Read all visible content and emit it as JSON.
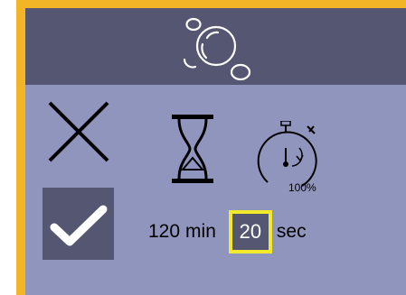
{
  "header": {
    "icon": "bubbles-icon"
  },
  "actions": {
    "cancel_icon": "close-icon",
    "confirm_icon": "checkmark-icon"
  },
  "indicators": {
    "hourglass_icon": "hourglass-icon",
    "timer_icon": "stopwatch-icon",
    "timer_percent": "100%"
  },
  "time": {
    "minutes": "120",
    "minutes_unit": "min",
    "seconds": "20",
    "seconds_unit": "sec"
  },
  "colors": {
    "frame": "#f2b527",
    "header": "#545672",
    "screen": "#8f95bd",
    "highlight": "#f2e92a"
  }
}
